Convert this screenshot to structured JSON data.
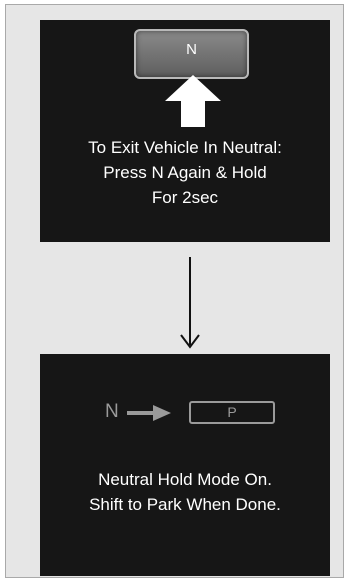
{
  "top_screen": {
    "key_label": "N",
    "message_lines": [
      "To Exit Vehicle In Neutral:",
      "Press N Again & Hold",
      "For 2sec"
    ]
  },
  "bottom_screen": {
    "from_gear": "N",
    "to_gear": "P",
    "message_lines": [
      "Neutral Hold Mode On.",
      "Shift to Park When Done."
    ]
  },
  "colors": {
    "screen_bg": "#161616",
    "frame_bg": "#e6e6e6",
    "text": "#ffffff",
    "dim_text": "#9a9a9a"
  },
  "icons": {
    "up_arrow": "up-arrow-icon",
    "down_arrow": "down-arrow-icon",
    "right_arrow": "right-arrow-icon"
  }
}
